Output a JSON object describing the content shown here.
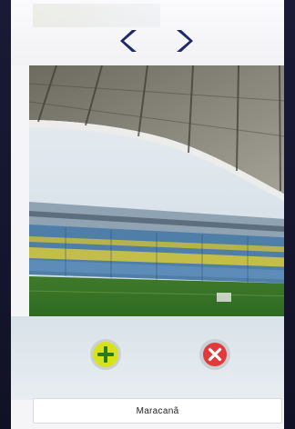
{
  "navigation": {
    "prev_icon": "chevron-left-icon",
    "next_icon": "chevron-right-icon",
    "arrow_color": "#1d2b6b"
  },
  "actions": {
    "add_icon": "plus-circle-icon",
    "remove_icon": "close-circle-icon",
    "add_color": "#d8e21b",
    "remove_color": "#e23a3a"
  },
  "caption": {
    "text": "Maracanã"
  }
}
